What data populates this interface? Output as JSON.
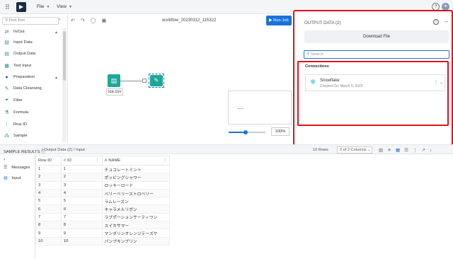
{
  "topbar": {
    "menus": [
      "File",
      "View"
    ]
  },
  "sidebar": {
    "find_placeholder": "Find Tool",
    "items": [
      {
        "label": "In/Out",
        "kind": "category"
      },
      {
        "label": "Input Data",
        "kind": "tool"
      },
      {
        "label": "Output Data",
        "kind": "tool"
      },
      {
        "label": "Text Input",
        "kind": "tool"
      },
      {
        "label": "Preparation",
        "kind": "category"
      },
      {
        "label": "Data Cleansing",
        "kind": "tool"
      },
      {
        "label": "Filter",
        "kind": "tool"
      },
      {
        "label": "Formula",
        "kind": "tool"
      },
      {
        "label": "Row ID",
        "kind": "tool"
      },
      {
        "label": "Sample",
        "kind": "tool"
      }
    ]
  },
  "canvas": {
    "workflow_title": "workflow_20230312_115322",
    "run_label": "Run Job",
    "input_node_label": "ice.csv",
    "zoom": "100%",
    "zoom_level_fraction": 0.46
  },
  "output_panel": {
    "title": "OUTPUT DATA (2)",
    "download_label": "Download File",
    "search_placeholder": "Search",
    "connections_heading": "Connections",
    "connection_name": "Snowflake",
    "connection_created": "Created On: March 9, 2023"
  },
  "results": {
    "title": "SAMPLE RESULTS",
    "breadcrumb": "/ Output Data (2) / Input",
    "rows_count": "10 Rows",
    "columns_selector": "2 of 2 Columns"
  },
  "bottom_nav": {
    "messages_label": "Messages",
    "input_label": "Input"
  },
  "table": {
    "headers": [
      "Row ID",
      "ID",
      "NAME"
    ],
    "rows": [
      [
        "1",
        "1",
        "チョコレートミント"
      ],
      [
        "2",
        "2",
        "ポッピングシャワー"
      ],
      [
        "3",
        "3",
        "ロッキーロード"
      ],
      [
        "4",
        "4",
        "ベリーベリーストロベリー"
      ],
      [
        "5",
        "5",
        "ラムレーズン"
      ],
      [
        "6",
        "6",
        "キャラメルリボン"
      ],
      [
        "7",
        "7",
        "ラブポーションサーティワン"
      ],
      [
        "8",
        "8",
        "スイカサマー"
      ],
      [
        "9",
        "9",
        "マンダリンオレンジテーズケ"
      ],
      [
        "10",
        "10",
        "パンプキンプリン"
      ]
    ]
  }
}
